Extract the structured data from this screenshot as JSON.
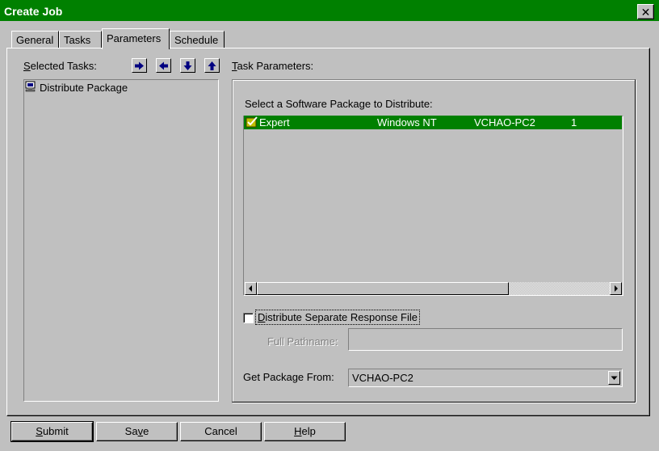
{
  "window": {
    "title": "Create Job",
    "close_glyph": "✕"
  },
  "tabs": [
    {
      "label": "General",
      "active": false
    },
    {
      "label": "Tasks",
      "active": false
    },
    {
      "label": "Parameters",
      "active": true
    },
    {
      "label": "Schedule",
      "active": false
    }
  ],
  "left": {
    "label_access": "S",
    "label_rest": "elected Tasks:",
    "buttons": [
      "arrow-right-icon",
      "arrow-left-icon",
      "arrow-down-icon",
      "arrow-up-icon"
    ],
    "tasks": [
      {
        "icon": "task-computer-icon",
        "label": "Distribute Package"
      }
    ]
  },
  "right": {
    "label_access": "T",
    "label_rest": "ask Parameters:",
    "package_list_label": "Select a Software Package to Distribute:",
    "packages": [
      {
        "icon": "package-check-icon",
        "name": "Expert",
        "os": "Windows NT",
        "source": "VCHAO-PC2",
        "count": "1",
        "selected": true
      }
    ],
    "scrollbar": {
      "position": 0
    },
    "separate_response": {
      "label_access": "D",
      "label_rest": "istribute Separate Response File",
      "checked": false
    },
    "full_path_label": "Full Pathname:",
    "full_path_value": "",
    "get_from_label": "Get Package From:",
    "get_from_value": "VCHAO-PC2"
  },
  "buttons": {
    "submit": {
      "access": "S",
      "rest": "ubmit"
    },
    "save": {
      "pre": "Sa",
      "access": "v",
      "rest": "e"
    },
    "cancel": "Cancel",
    "help": {
      "access": "H",
      "rest": "elp"
    }
  },
  "colors": {
    "titlebar": "#008000",
    "selection": "#008000",
    "face": "#c0c0c0"
  }
}
